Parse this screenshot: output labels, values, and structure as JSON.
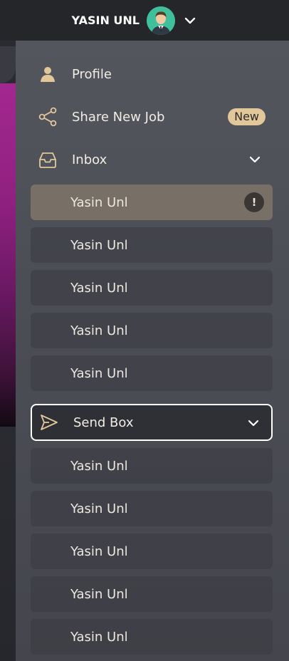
{
  "header": {
    "user_name": "YASIN UNL",
    "avatar_icon": "user-avatar",
    "dropdown_icon": "chevron-down-icon"
  },
  "menu": {
    "profile_label": "Profile",
    "share_label": "Share New Job",
    "share_badge": "New",
    "inbox_label": "Inbox",
    "sendbox_label": "Send Box"
  },
  "inbox_items": [
    {
      "name": "Yasin Unl",
      "alert": "!"
    },
    {
      "name": "Yasin Unl"
    },
    {
      "name": "Yasin Unl"
    },
    {
      "name": "Yasin Unl"
    },
    {
      "name": "Yasin Unl"
    }
  ],
  "sendbox_items": [
    {
      "name": "Yasin Unl"
    },
    {
      "name": "Yasin Unl"
    },
    {
      "name": "Yasin Unl"
    },
    {
      "name": "Yasin Unl"
    },
    {
      "name": "Yasin Unl"
    }
  ],
  "colors": {
    "accent": "#e2c79b",
    "active_item": "#786f67",
    "avatar_bg": "#3fbf9b"
  }
}
